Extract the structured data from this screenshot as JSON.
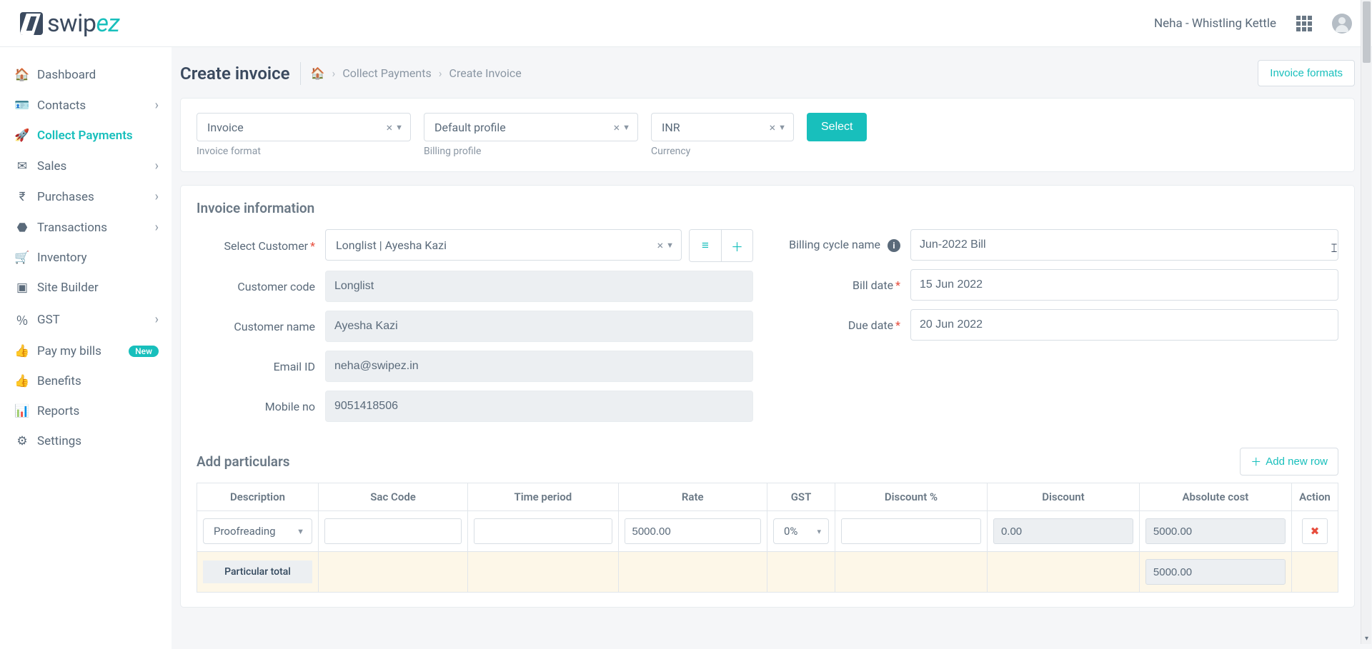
{
  "header": {
    "user_name": "Neha - Whistling Kettle"
  },
  "sidebar": {
    "items": [
      {
        "label": "Dashboard",
        "icon": "🏠",
        "expandable": false
      },
      {
        "label": "Contacts",
        "icon": "👤",
        "expandable": true
      },
      {
        "label": "Collect Payments",
        "icon": "🚀",
        "expandable": false,
        "active": true
      },
      {
        "label": "Sales",
        "icon": "✉",
        "expandable": true
      },
      {
        "label": "Purchases",
        "icon": "₹",
        "expandable": true
      },
      {
        "label": "Transactions",
        "icon": "🗂",
        "expandable": true
      },
      {
        "label": "Inventory",
        "icon": "🛒",
        "expandable": false
      },
      {
        "label": "Site Builder",
        "icon": "🖥",
        "expandable": false
      },
      {
        "label": "GST",
        "icon": "％",
        "expandable": true
      },
      {
        "label": "Pay my bills",
        "icon": "👍",
        "expandable": false,
        "badge": "New"
      },
      {
        "label": "Benefits",
        "icon": "👍",
        "expandable": false
      },
      {
        "label": "Reports",
        "icon": "📊",
        "expandable": false
      },
      {
        "label": "Settings",
        "icon": "⚙",
        "expandable": false
      }
    ]
  },
  "page": {
    "title": "Create invoice",
    "breadcrumb": {
      "home": "🏠",
      "l1": "Collect Payments",
      "l2": "Create Invoice"
    },
    "invoice_formats_btn": "Invoice formats"
  },
  "selectors": {
    "format": {
      "value": "Invoice",
      "label": "Invoice format"
    },
    "profile": {
      "value": "Default profile",
      "label": "Billing profile"
    },
    "currency": {
      "value": "INR",
      "label": "Currency"
    },
    "select_btn": "Select"
  },
  "invoice_info": {
    "section_title": "Invoice information",
    "labels": {
      "select_customer": "Select Customer",
      "customer_code": "Customer code",
      "customer_name": "Customer name",
      "email": "Email ID",
      "mobile": "Mobile no",
      "billing_cycle": "Billing cycle name",
      "bill_date": "Bill date",
      "due_date": "Due date"
    },
    "values": {
      "customer_select": "Longlist | Ayesha Kazi",
      "customer_code": "Longlist",
      "customer_name": "Ayesha Kazi",
      "email": "neha@swipez.in",
      "mobile": "9051418506",
      "billing_cycle": "Jun-2022 Bill",
      "bill_date": "15 Jun 2022",
      "due_date": "20 Jun 2022"
    }
  },
  "particulars": {
    "section_title": "Add particulars",
    "add_row_btn": "Add new row",
    "columns": [
      "Description",
      "Sac Code",
      "Time period",
      "Rate",
      "GST",
      "Discount %",
      "Discount",
      "Absolute cost",
      "Action"
    ],
    "rows": [
      {
        "description": "Proofreading",
        "sac": "",
        "time": "",
        "rate": "5000.00",
        "gst": "0%",
        "discount_pct": "",
        "discount": "0.00",
        "absolute": "5000.00"
      }
    ],
    "total": {
      "label": "Particular total",
      "absolute": "5000.00"
    }
  }
}
